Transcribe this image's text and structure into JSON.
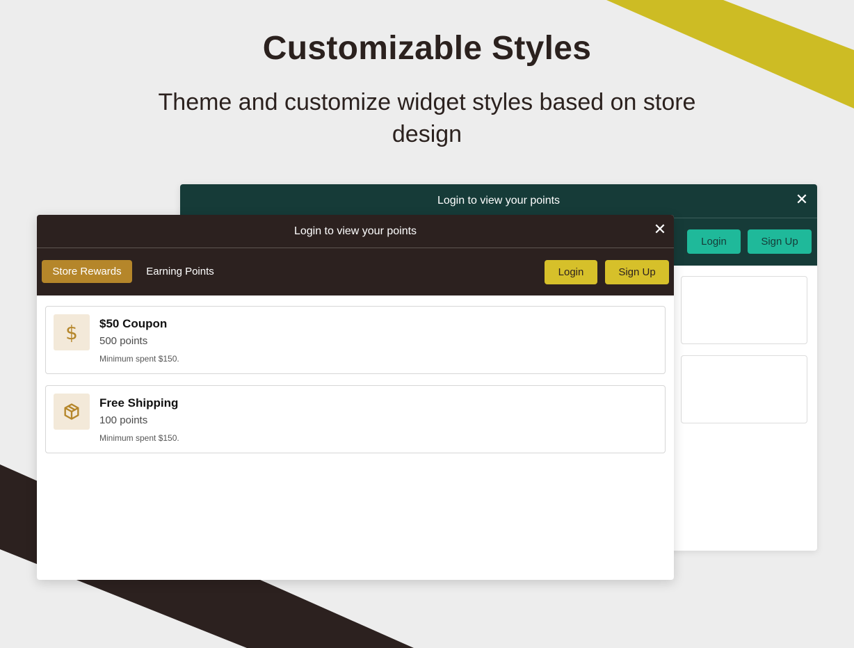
{
  "hero": {
    "title": "Customizable Styles",
    "subtitle": "Theme and customize widget styles based on store design"
  },
  "colors": {
    "page_bg": "#ededed",
    "accent_yellow": "#cdbc24",
    "accent_dark": "#2c211f",
    "green_header": "#163b38",
    "green_button": "#1fb99a",
    "brown_active_tab": "#b5862a",
    "yellow_button": "#d6c02a",
    "icon_bg": "#f3e9d9",
    "icon_color": "#b5862a"
  },
  "back_widget": {
    "header_text": "Login to view your points",
    "close_icon": "close-icon",
    "login_label": "Login",
    "signup_label": "Sign Up"
  },
  "front_widget": {
    "header_text": "Login to view your points",
    "close_icon": "close-icon",
    "tabs": [
      {
        "label": "Store Rewards",
        "active": true
      },
      {
        "label": "Earning Points",
        "active": false
      }
    ],
    "login_label": "Login",
    "signup_label": "Sign Up",
    "rewards": [
      {
        "icon": "dollar-icon",
        "title": "$50 Coupon",
        "points": "500 points",
        "condition": "Minimum spent $150."
      },
      {
        "icon": "package-icon",
        "title": "Free Shipping",
        "points": "100 points",
        "condition": "Minimum spent $150."
      }
    ]
  }
}
